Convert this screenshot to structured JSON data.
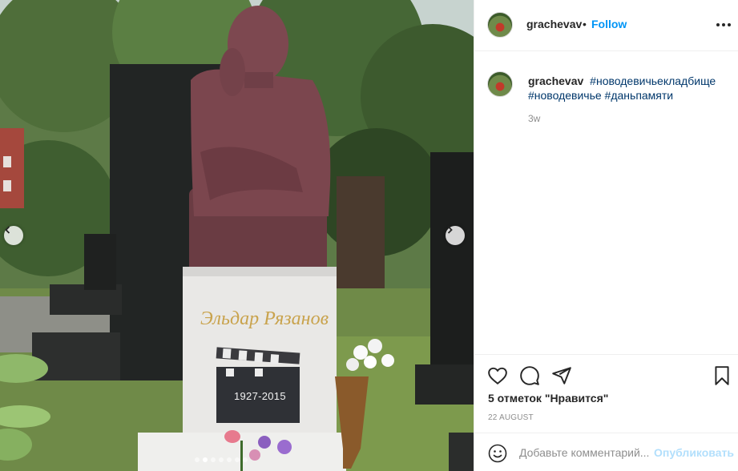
{
  "post": {
    "username": "grachevav",
    "separator": "•",
    "follow_label": "Follow",
    "more_icon": "more-horizontal-icon"
  },
  "caption": {
    "username": "grachevav",
    "hashtags": [
      "#новодевичьекладбище",
      "#новодевичье",
      "#даньпамяти"
    ],
    "time": "3w"
  },
  "photo": {
    "plaque_text": "Эльдар Рязанов",
    "dates": "1927-2015",
    "carousel_dots": 7,
    "active_dot": 1
  },
  "actions": {
    "like_icon": "heart-icon",
    "comment_icon": "comment-icon",
    "share_icon": "send-icon",
    "save_icon": "bookmark-icon"
  },
  "likes_text": "5 отметок \"Нравится\"",
  "date_text": "22 AUGUST",
  "add_comment": {
    "placeholder": "Добавьте комментарий...",
    "post_label": "Опубликовать",
    "emoji_icon": "emoji-icon"
  },
  "colors": {
    "accent": "#0095f6",
    "hashtag": "#00376b",
    "muted": "#8e8e8e",
    "post_disabled": "#b2dffc"
  }
}
